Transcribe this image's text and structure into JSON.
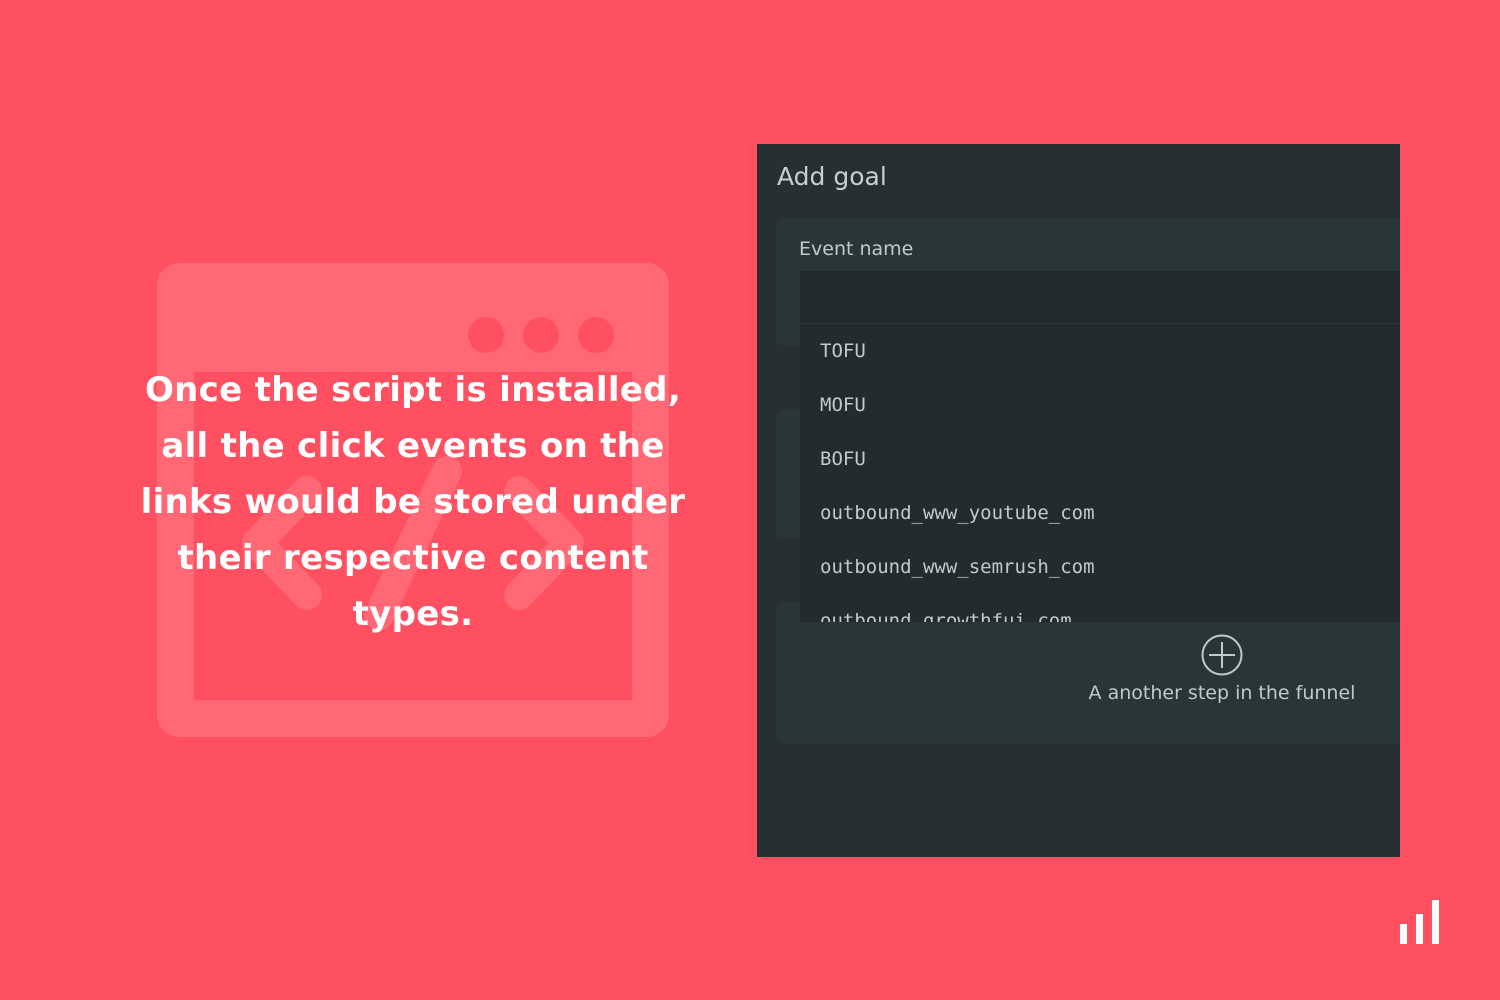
{
  "headline": "Once the script is installed, all the click events on the links would be stored under their respective content types.",
  "goal_panel": {
    "title": "Add goal",
    "event_name_label": "Event name",
    "event_name_value": "",
    "options": [
      {
        "label": "TOFU"
      },
      {
        "label": "MOFU"
      },
      {
        "label": "BOFU"
      },
      {
        "label": "outbound_www_youtube_com"
      },
      {
        "label": "outbound_www_semrush_com"
      },
      {
        "label": "outbound_growthfui_com"
      }
    ],
    "add_step_label": "A another step in the funnel"
  },
  "icons": {
    "background": "code-window-icon",
    "add_step": "plus-circle-icon",
    "brand": "bar-chart-logo-icon"
  },
  "colors": {
    "background": "#ff5062",
    "illustration": "#ff6874",
    "panel": "#263033",
    "card": "#2a3538",
    "dropdown": "#232b2d",
    "panel_text": "#c0caca",
    "headline": "#ffffff"
  }
}
